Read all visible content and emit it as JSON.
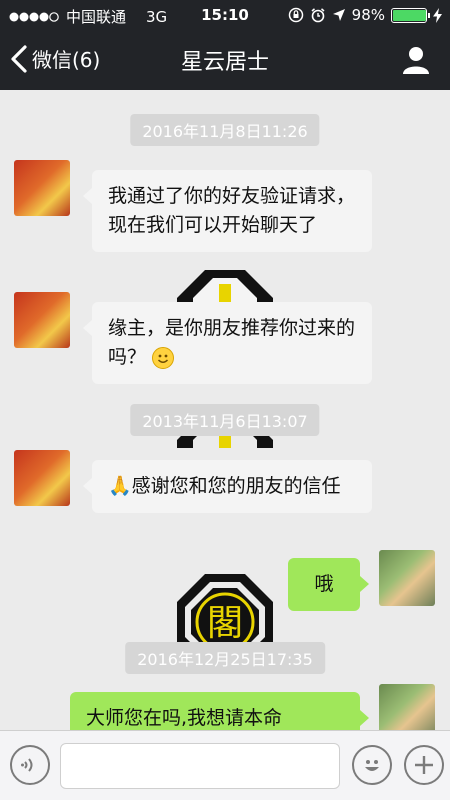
{
  "status_bar": {
    "carrier": "中国联通",
    "network": "3G",
    "time": "15:10",
    "battery_percent_text": "98%",
    "battery_level": 0.98
  },
  "nav": {
    "back_label": "微信(6)",
    "title": "星云居士"
  },
  "chat": {
    "timestamps": [
      "2016年11月8日11:26",
      "2013年11月6日13:07",
      "2016年12月25日17:35"
    ],
    "messages": [
      {
        "side": "left",
        "text": "我通过了你的好友验证请求，现在我们可以开始聊天了"
      },
      {
        "side": "left",
        "text": "缘主，是你朋友推荐你过来的吗？"
      },
      {
        "side": "left",
        "text": "感谢您和您的朋友的信任"
      },
      {
        "side": "right",
        "text": "哦"
      },
      {
        "side": "right",
        "text": "大师您在吗,我想请本命"
      }
    ],
    "watermark_text": "閣"
  },
  "colors": {
    "bar_bg": "#222428",
    "chat_bg": "#ebebeb",
    "bubble_right": "#a0e75a",
    "bubble_left": "#f4f4f4"
  },
  "icons": [
    "back-chevron-icon",
    "user-profile-icon",
    "voice-icon",
    "emoji-icon",
    "plus-icon",
    "lock-rotation-icon",
    "alarm-icon",
    "location-arrow-icon",
    "signal-dots-icon",
    "charging-bolt-icon"
  ]
}
